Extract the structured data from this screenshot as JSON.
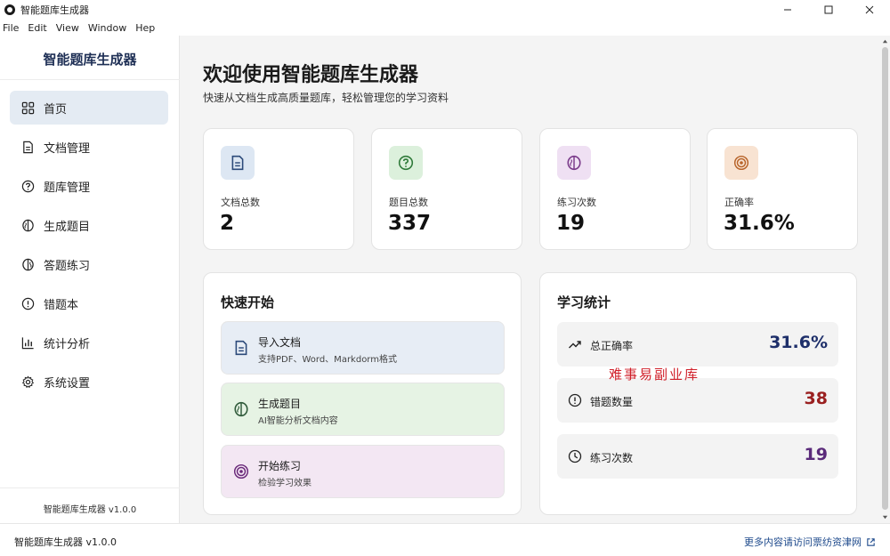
{
  "window": {
    "title": "智能题库生成器",
    "controls": [
      "minimize-icon",
      "maximize-icon",
      "close-icon"
    ]
  },
  "menubar": {
    "items": [
      "File",
      "Edit",
      "View",
      "Window",
      "Hep"
    ]
  },
  "sidebar": {
    "brand": "智能题库生成器",
    "items": [
      {
        "label": "首页",
        "icon": "grid-icon",
        "active": true
      },
      {
        "label": "文档管理",
        "icon": "document-icon"
      },
      {
        "label": "题库管理",
        "icon": "question-icon"
      },
      {
        "label": "生成题目",
        "icon": "brain-icon"
      },
      {
        "label": "答题练习",
        "icon": "brain-icon"
      },
      {
        "label": "错题本",
        "icon": "alert-icon"
      },
      {
        "label": "统计分析",
        "icon": "bar-chart-icon"
      },
      {
        "label": "系统设置",
        "icon": "gear-icon"
      }
    ],
    "version": "智能题库生成器 v1.0.0"
  },
  "main": {
    "title": "欢迎使用智能题库生成器",
    "subtitle": "快速从文档生成高质量题库，轻松管理您的学习资料",
    "stats": [
      {
        "label": "文档总数",
        "value": "2",
        "icon": "document-icon",
        "bg": "#dde7f3",
        "fg": "#2c4a7a"
      },
      {
        "label": "题目总数",
        "value": "337",
        "icon": "question-icon",
        "bg": "#dcf0dc",
        "fg": "#2f7a3a"
      },
      {
        "label": "练习次数",
        "value": "19",
        "icon": "brain-icon",
        "bg": "#efe0f3",
        "fg": "#7a3a8a"
      },
      {
        "label": "正确率",
        "value": "31.6%",
        "icon": "target-icon",
        "bg": "#f8e3d2",
        "fg": "#b8642a"
      }
    ],
    "quick_start": {
      "title": "快速开始",
      "items": [
        {
          "name": "导入文档",
          "desc": "支持PDF、Word、Markdorm格式",
          "icon": "document-icon",
          "bg": "#e7edf5",
          "fg": "#2c4a7a"
        },
        {
          "name": "生成题目",
          "desc": "AI智能分析文档内容",
          "icon": "brain-icon",
          "bg": "#e6f3e4",
          "fg": "#2f5a3a"
        },
        {
          "name": "开始练习",
          "desc": "检验学习效果",
          "icon": "target-icon",
          "bg": "#f3e7f3",
          "fg": "#6a2a7a"
        }
      ]
    },
    "learning_stats": {
      "title": "学习统计",
      "items": [
        {
          "label": "总正确率",
          "value": "31.6%",
          "icon": "trend-up-icon",
          "color": "#1e2f6a"
        },
        {
          "label": "错题数量",
          "value": "38",
          "icon": "alert-icon",
          "color": "#9a2020"
        },
        {
          "label": "练习次数",
          "value": "19",
          "icon": "clock-icon",
          "color": "#5a2a7a"
        }
      ]
    }
  },
  "watermark": "难事易副业库",
  "statusbar": {
    "left": "智能题库生成器 v1.0.0",
    "right": "更多内容请访问票纺资津网"
  }
}
